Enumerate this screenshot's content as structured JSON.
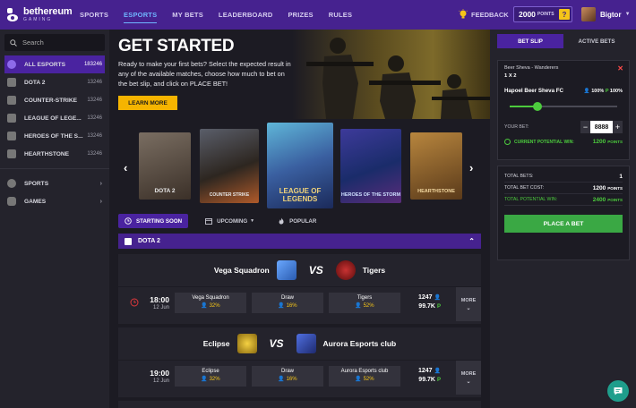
{
  "colors": {
    "primary": "#46228f",
    "accent": "#f5b400",
    "green": "#4ccb3d",
    "panel": "#24232c"
  },
  "header": {
    "logo_name": "bethereum",
    "logo_sub": "GAMING",
    "nav": [
      "SPORTS",
      "ESPORTS",
      "MY BETS",
      "LEADERBOARD",
      "PRIZES",
      "RULES"
    ],
    "active_nav": "ESPORTS",
    "feedback": "FEEDBACK",
    "points_value": "2000",
    "points_unit": "POINTS",
    "help": "?",
    "username": "Bigtor"
  },
  "sidebar": {
    "search_placeholder": "Search",
    "items": [
      {
        "label": "ALL ESPORTS",
        "count": "183246",
        "icon": "all-esports-icon"
      },
      {
        "label": "DOTA 2",
        "count": "13246",
        "icon": "dota2-icon"
      },
      {
        "label": "COUNTER-STRIKE",
        "count": "13246",
        "icon": "counter-strike-icon"
      },
      {
        "label": "LEAGUE OF LEGE...",
        "count": "13246",
        "icon": "league-of-legends-icon"
      },
      {
        "label": "HEROES OF THE S...",
        "count": "13246",
        "icon": "heroes-icon"
      },
      {
        "label": "HEARTHSTONE",
        "count": "13246",
        "icon": "hearthstone-icon"
      }
    ],
    "groups": [
      {
        "label": "SPORTS",
        "icon": "sports-icon"
      },
      {
        "label": "GAMES",
        "icon": "games-icon"
      }
    ]
  },
  "hero": {
    "title": "GET STARTED",
    "text": "Ready to make your first bets? Select the expected result in any of the available matches, choose how much to bet on the bet slip, and click on PLACE BET!",
    "button": "LEARN MORE"
  },
  "carousel": {
    "covers": [
      {
        "caption": "DOTA 2"
      },
      {
        "caption": "COUNTER STRIKE"
      },
      {
        "caption": "LEAGUE OF LEGENDS"
      },
      {
        "caption": "HEROES OF THE STORM"
      },
      {
        "caption": "HEARTHSTONE"
      }
    ]
  },
  "filters": {
    "tabs": [
      "STARTING SOON",
      "UPCOMING",
      "POPULAR"
    ]
  },
  "game": {
    "title": "DOTA 2"
  },
  "matches": [
    {
      "team1": "Vega Squadron",
      "team2": "Tigers",
      "vs": "VS",
      "time": "18:00",
      "date": "12 Jun",
      "odds": [
        {
          "name": "Vega Squadron",
          "pct": "32%"
        },
        {
          "name": "Draw",
          "pct": "16%"
        },
        {
          "name": "Tigers",
          "pct": "52%"
        }
      ],
      "bettors": "1247",
      "volume": "99.7K",
      "more": "MORE"
    },
    {
      "team1": "Eclipse",
      "team2": "Aurora Esports club",
      "vs": "VS",
      "time": "19:00",
      "date": "12 Jun",
      "odds": [
        {
          "name": "Eclipse",
          "pct": "32%"
        },
        {
          "name": "Draw",
          "pct": "16%"
        },
        {
          "name": "Aurora Esports club",
          "pct": "52%"
        }
      ],
      "bettors": "1247",
      "volume": "99.7K",
      "more": "MORE"
    }
  ],
  "betslip": {
    "tabs": [
      "BET SLIP",
      "ACTIVE BETS"
    ],
    "event": "Beer Sheva - Wanderers",
    "market": "1 X 2",
    "pick": "Hapoel Beer Sheva FC",
    "pick_pct": "100%",
    "pick_p": "100%",
    "slider_fraction": 0.25,
    "your_bet_label": "YOUR BET:",
    "bet_value": "8888",
    "potential_label": "CURRENT POTENTIAL WIN:",
    "potential_value": "1200",
    "points_unit": "POINTS",
    "summary": [
      {
        "label": "TOTAL BETS:",
        "value": "1",
        "unit": ""
      },
      {
        "label": "TOTAL BET COST:",
        "value": "1200",
        "unit": "POINTS"
      },
      {
        "label": "TOTAL POTENTIAL WIN:",
        "value": "2400",
        "unit": "POINTS"
      }
    ],
    "place_bet": "PLACE A BET"
  }
}
